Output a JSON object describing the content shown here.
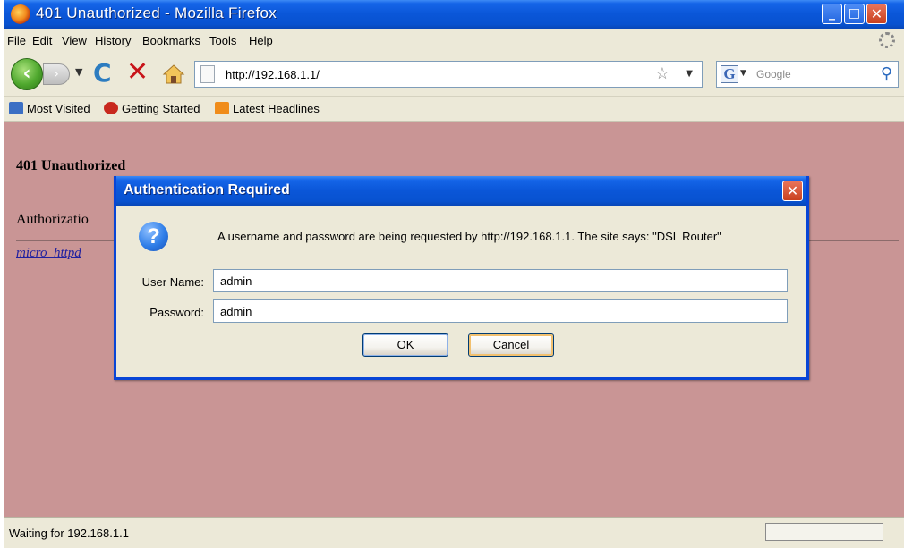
{
  "window": {
    "title": "401 Unauthorized - Mozilla Firefox"
  },
  "menu": {
    "items": [
      "File",
      "Edit",
      "View",
      "History",
      "Bookmarks",
      "Tools",
      "Help"
    ]
  },
  "nav": {
    "url": "http://192.168.1.1/",
    "search_placeholder": "Google"
  },
  "bookmarks": {
    "items": [
      "Most Visited",
      "Getting Started",
      "Latest Headlines"
    ]
  },
  "page": {
    "heading": "401 Unauthorized",
    "message": "Authorizatio",
    "link_text": "micro_httpd"
  },
  "dialog": {
    "title": "Authentication Required",
    "message": "A username and password are being requested by http://192.168.1.1. The site says: \"DSL Router\"",
    "username_label": "User Name:",
    "username_value": "admin",
    "password_label": "Password:",
    "password_value": "admin",
    "ok_label": "OK",
    "cancel_label": "Cancel"
  },
  "status": {
    "text": "Waiting for 192.168.1.1"
  },
  "colors": {
    "content_bg": "#C99595",
    "titlebar_blue": "#0A56D8",
    "chrome_bg": "#ECE9D8"
  }
}
